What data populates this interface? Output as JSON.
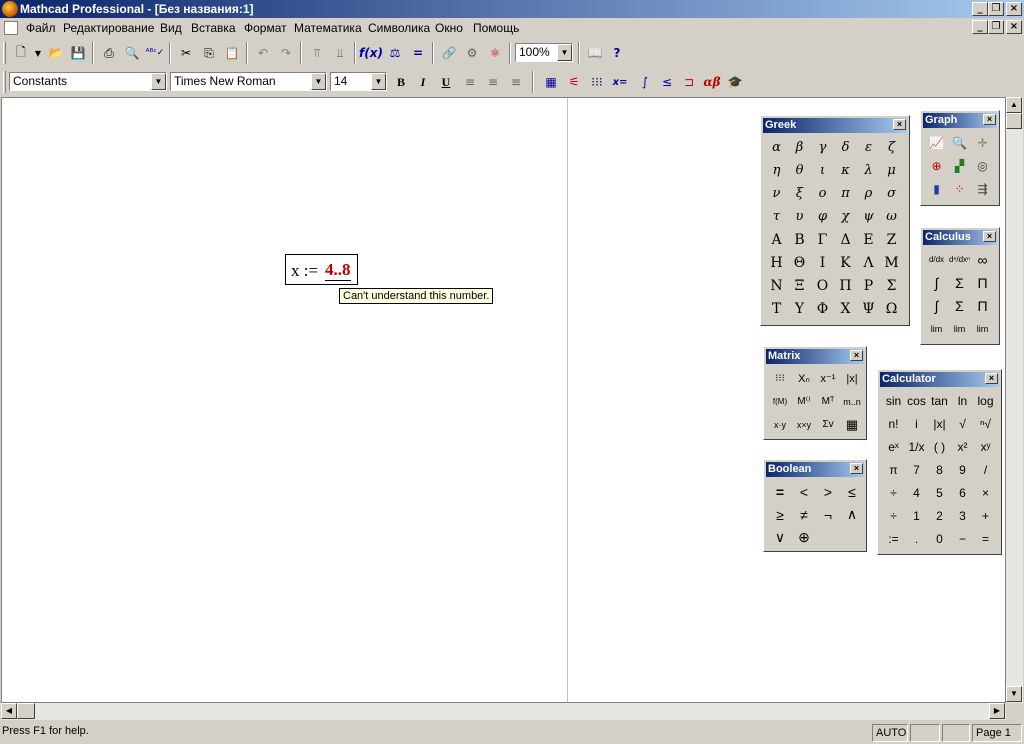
{
  "app": {
    "title": "Mathcad Professional - [Без названия:1]"
  },
  "menu": [
    "Файл",
    "Редактирование",
    "Вид",
    "Вставка",
    "Формат",
    "Математика",
    "Символика",
    "Окно",
    "Помощь"
  ],
  "toolbar": {
    "zoom": "100%"
  },
  "format_bar": {
    "style": "Constants",
    "font": "Times New Roman",
    "size": "14",
    "bold": "B",
    "italic": "I",
    "underline": "U"
  },
  "worksheet": {
    "region_lhs": "x :=",
    "region_rhs": "4..8",
    "error_tooltip": "Can't understand this number."
  },
  "palettes": {
    "greek": {
      "title": "Greek",
      "symbols": [
        "α",
        "β",
        "γ",
        "δ",
        "ε",
        "ζ",
        "η",
        "θ",
        "ι",
        "κ",
        "λ",
        "μ",
        "ν",
        "ξ",
        "ο",
        "π",
        "ρ",
        "σ",
        "τ",
        "υ",
        "φ",
        "χ",
        "ψ",
        "ω",
        "Α",
        "Β",
        "Γ",
        "Δ",
        "Ε",
        "Ζ",
        "Η",
        "Θ",
        "Ι",
        "Κ",
        "Λ",
        "Μ",
        "Ν",
        "Ξ",
        "Ο",
        "Π",
        "Ρ",
        "Σ",
        "Τ",
        "Υ",
        "Φ",
        "Χ",
        "Ψ",
        "Ω"
      ]
    },
    "graph": {
      "title": "Graph"
    },
    "calculus": {
      "title": "Calculus",
      "symbols": [
        "d/dx",
        "dⁿ/dxⁿ",
        "∞",
        "∫",
        "Σ",
        "Π",
        "∫",
        "Σ",
        "Π",
        "lim",
        "lim",
        "lim"
      ]
    },
    "matrix": {
      "title": "Matrix",
      "symbols": [
        "⁝⁝⁝",
        "Xₙ",
        "x⁻¹",
        "|x|",
        "f(M)",
        "M⁽⁾",
        "Mᵀ",
        "m..n",
        "x·y",
        "x×y",
        "Σv",
        "▦"
      ]
    },
    "calculator": {
      "title": "Calculator",
      "symbols": [
        "sin",
        "cos",
        "tan",
        "ln",
        "log",
        "n!",
        "i",
        "|x|",
        "√",
        "ⁿ√",
        "eˣ",
        "1/x",
        "( )",
        "x²",
        "xʸ",
        "π",
        "7",
        "8",
        "9",
        "/",
        "÷",
        "4",
        "5",
        "6",
        "×",
        "÷",
        "1",
        "2",
        "3",
        "+",
        ":=",
        ".",
        "0",
        "−",
        "="
      ]
    },
    "boolean": {
      "title": "Boolean",
      "symbols": [
        "=",
        "<",
        ">",
        "≤",
        "≥",
        "≠",
        "¬",
        "∧",
        "∨",
        "⊕"
      ]
    }
  },
  "status": {
    "help": "Press F1 for help.",
    "mode": "AUTO",
    "page": "Page 1"
  }
}
